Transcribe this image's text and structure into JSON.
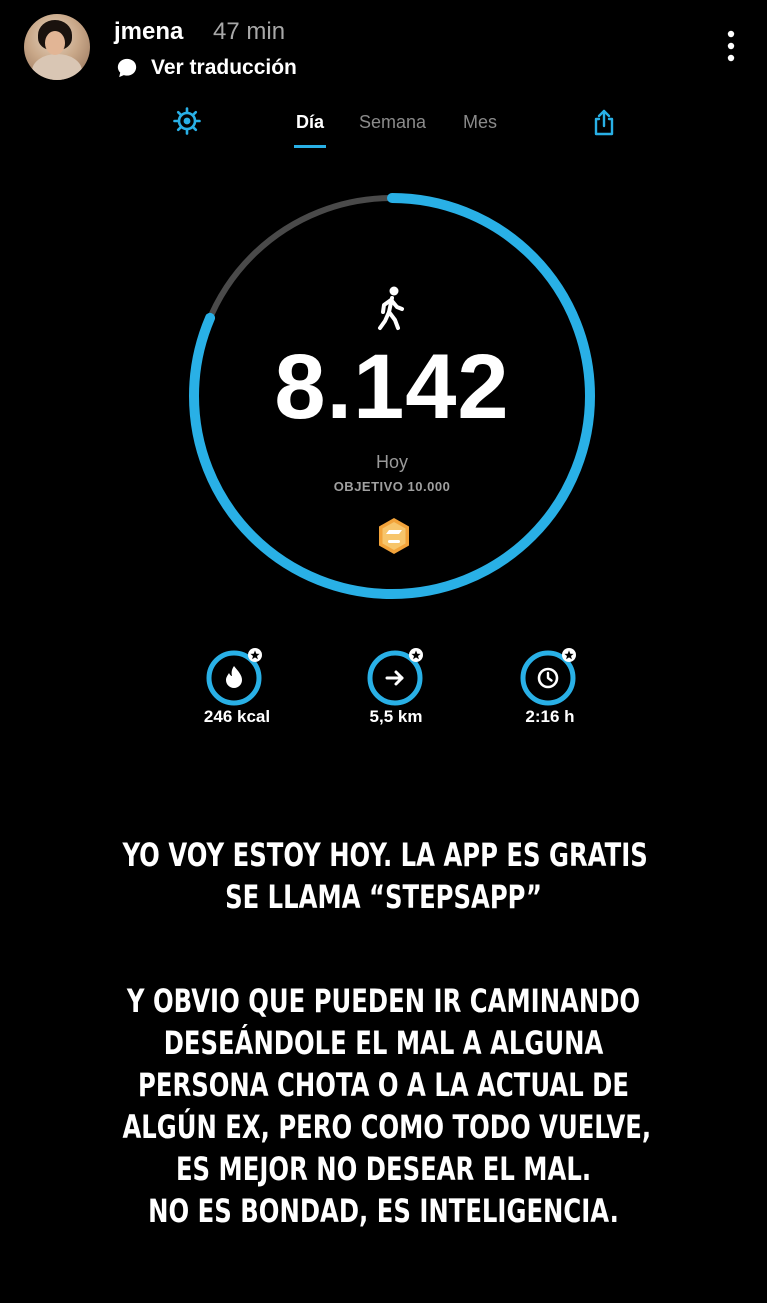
{
  "story": {
    "username": "jmena",
    "time": "47 min",
    "translate_label": "Ver traducción"
  },
  "app": {
    "tabs": [
      {
        "label": "Día",
        "active": true
      },
      {
        "label": "Semana",
        "active": false
      },
      {
        "label": "Mes",
        "active": false
      }
    ],
    "steps": "8.142",
    "steps_progress": 0.8142,
    "today_label": "Hoy",
    "goal_label": "OBJETIVO 10.000",
    "stats": [
      {
        "icon": "flame-icon",
        "value": "246 kcal"
      },
      {
        "icon": "arrow-right-icon",
        "value": "5,5 km"
      },
      {
        "icon": "clock-icon",
        "value": "2:16 h"
      }
    ]
  },
  "caption": {
    "paragraph_1": [
      "YO VOY ESTOY HOY. LA APP ES GRATIS",
      "SE LLAMA “STEPSAPP”"
    ],
    "paragraph_2": [
      "Y OBVIO QUE PUEDEN IR CAMINANDO",
      "DESEÁNDOLE EL MAL A ALGUNA",
      "PERSONA CHOTA O A LA ACTUAL DE",
      "ALGÚN EX, PERO COMO TODO VUELVE,",
      "ES MEJOR NO DESEAR EL MAL.",
      "NO ES BONDAD, ES INTELIGENCIA."
    ]
  },
  "colors": {
    "background": "#000000",
    "accent": "#29b0e6",
    "ring_track": "#4a4a4a",
    "badge": "#f2a33a"
  }
}
